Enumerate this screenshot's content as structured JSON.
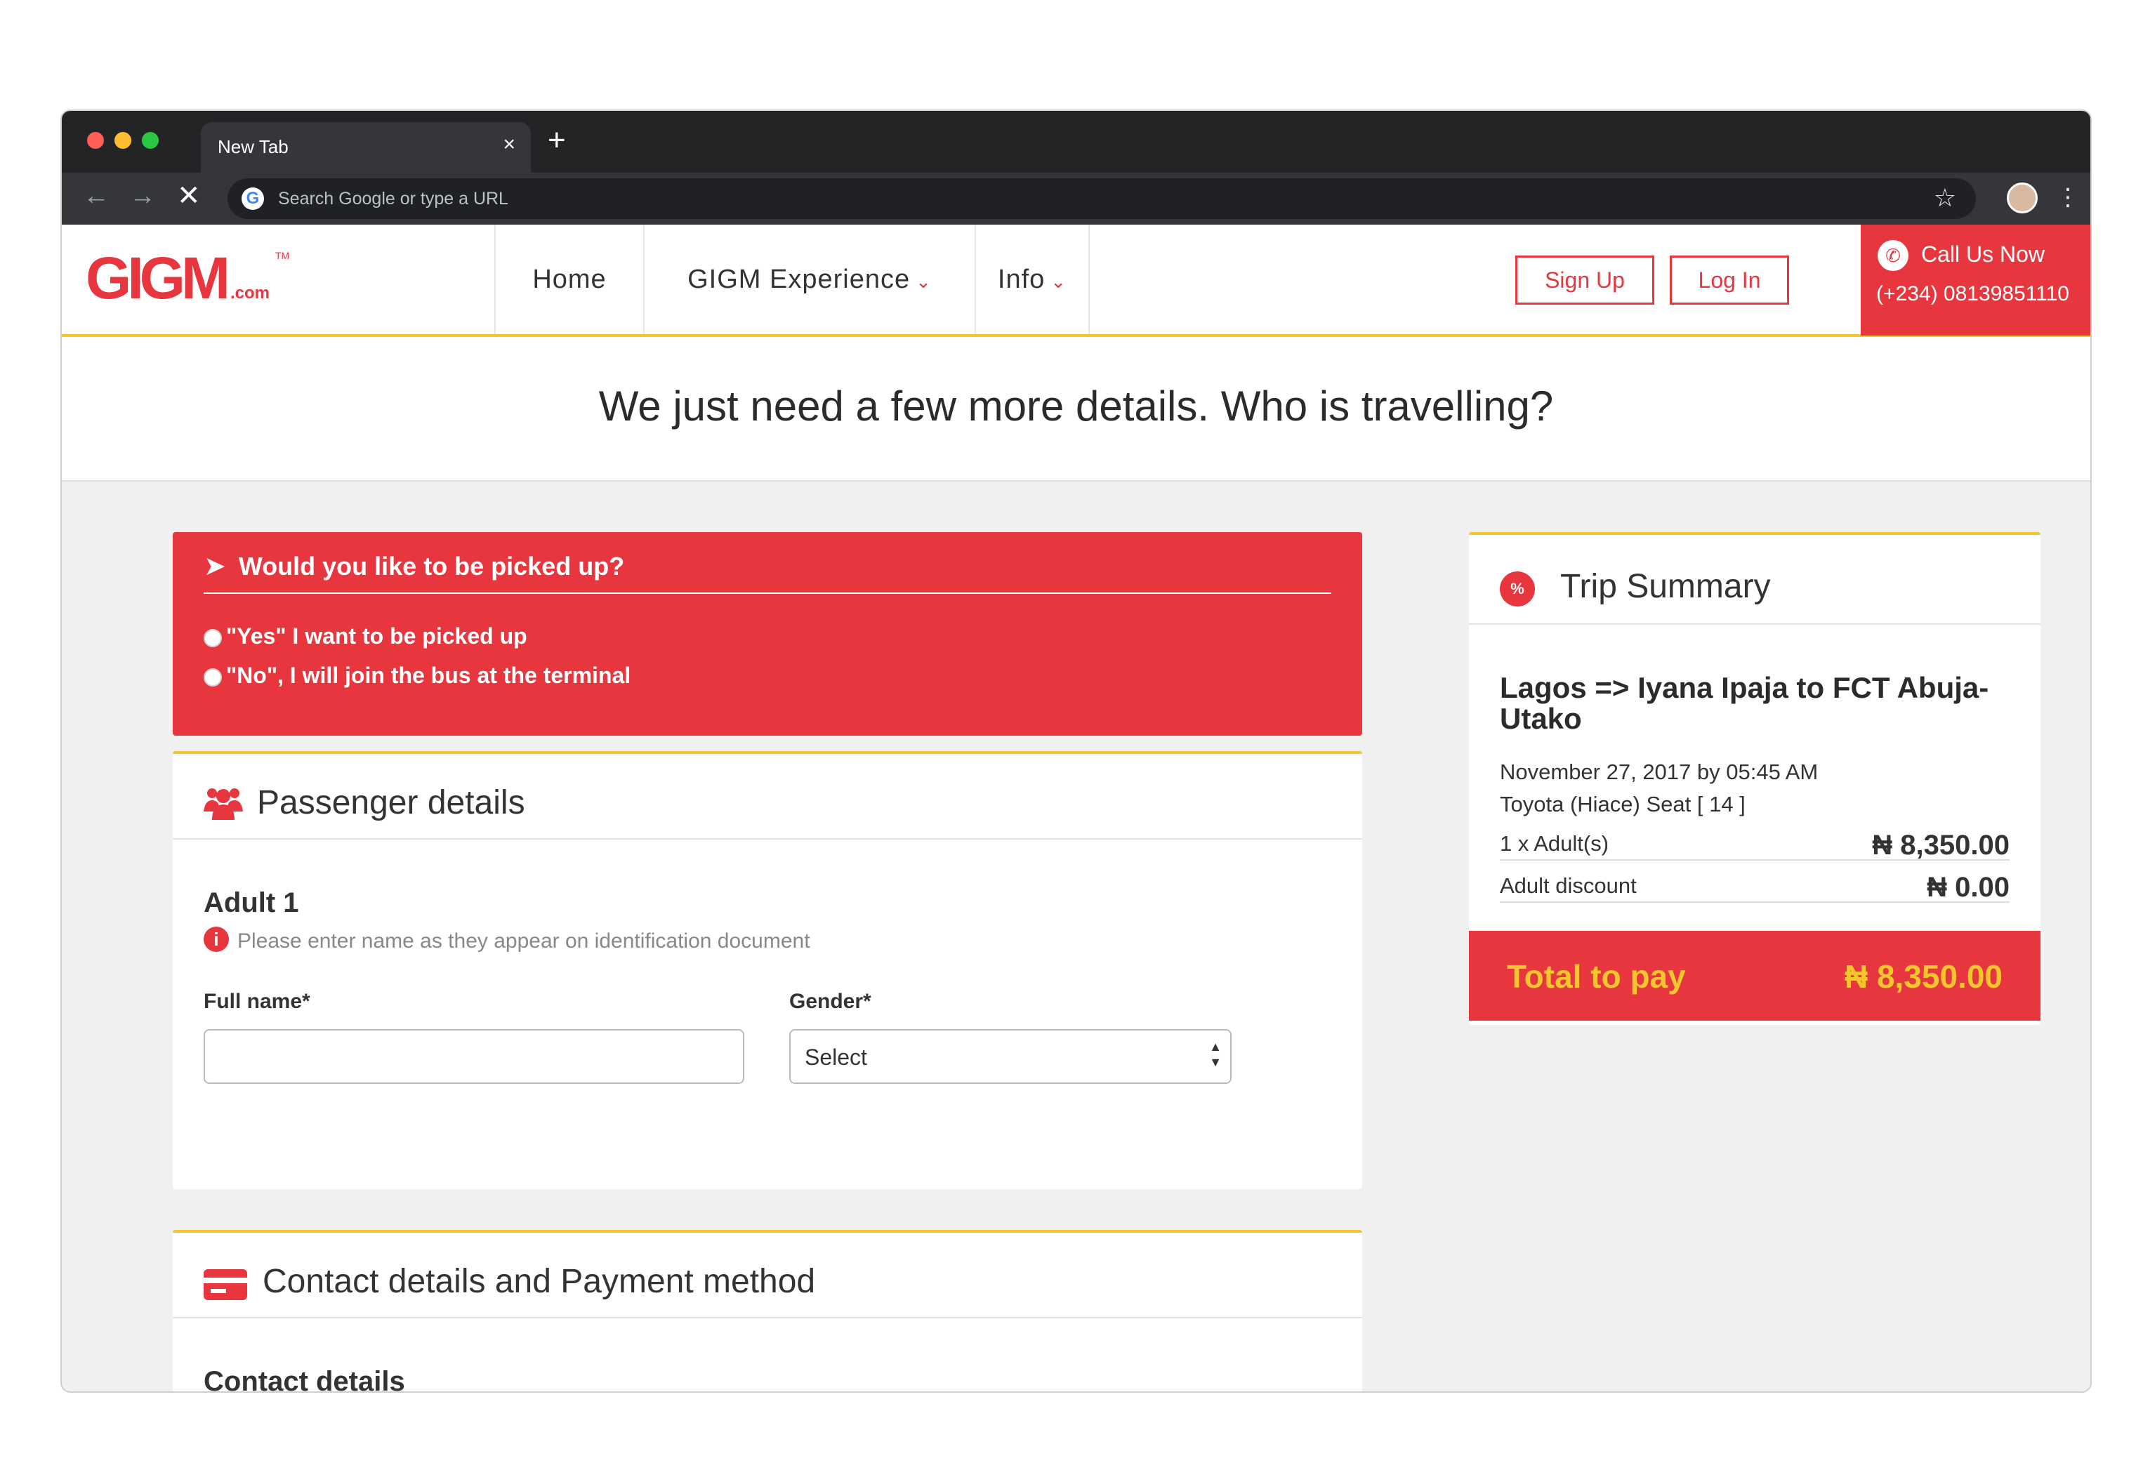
{
  "browser": {
    "tab_title": "New Tab",
    "tab_close": "×",
    "new_tab": "+",
    "back": "←",
    "forward": "→",
    "stop": "✕",
    "google_g": "G",
    "omnibox_placeholder": "Search Google or type a URL",
    "bookmark_star": "☆",
    "menu_dots": "⋮"
  },
  "header": {
    "logo_text": "GIGM",
    "logo_tld": ".com",
    "logo_tm": "TM",
    "nav": [
      {
        "label": "Home"
      },
      {
        "label": "GIGM Experience",
        "chevron": "⌄"
      },
      {
        "label": "Info",
        "chevron": "⌄"
      }
    ],
    "signup_label": "Sign Up",
    "login_label": "Log In",
    "call_title": "Call Us Now",
    "call_number": "(+234) 08139851110",
    "phone_glyph": "✆"
  },
  "page_title": "We just need a few more details. Who is travelling?",
  "pickup": {
    "arrow_glyph": "➤",
    "question": "Would you like to be picked up?",
    "options": [
      "\"Yes\" I want to be picked up",
      "\"No\", I will join the bus at the terminal"
    ]
  },
  "passenger": {
    "title": "Passenger details",
    "adult_label": "Adult 1",
    "info_glyph": "i",
    "note": "Please enter name as they appear on identification document",
    "fullname_label": "Full name*",
    "fullname_value": "",
    "gender_label": "Gender*",
    "gender_selected": "Select",
    "select_arrows": "▲▼"
  },
  "contact": {
    "title": "Contact details and Payment method",
    "subtitle": "Contact details"
  },
  "summary": {
    "pct_glyph": "%",
    "title": "Trip Summary",
    "route": "Lagos => Iyana Ipaja to FCT Abuja-Utako",
    "date": "November 27, 2017 by 05:45 AM",
    "vehicle_seat": "Toyota (Hiace) Seat [ 14 ]",
    "adults_label": "1 x Adult(s)",
    "adults_value": "₦ 8,350.00",
    "discount_label": "Adult discount",
    "discount_value": "₦ 0.00",
    "total_label": "Total to pay",
    "total_value": "₦ 8,350.00"
  },
  "colors": {
    "brand_red": "#e7363d",
    "accent_yellow": "#f3c62d",
    "chrome_dark": "#232426"
  }
}
